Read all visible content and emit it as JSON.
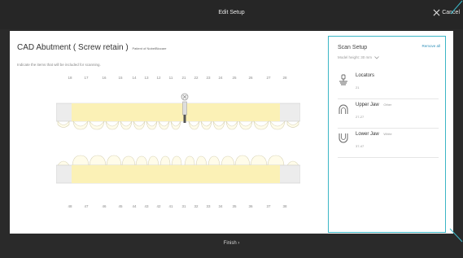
{
  "header": {
    "title": "Edit Setup",
    "cancel_label": "Cancel"
  },
  "main": {
    "title": "CAD Abutment ( Screw retain )",
    "patient": "Patient of NobelBiocare",
    "instruction": "Indicate the items that will be included for scanning.",
    "upper_numbers": [
      "18",
      "17",
      "16",
      "15",
      "14",
      "13",
      "12",
      "11",
      "21",
      "22",
      "23",
      "24",
      "25",
      "26",
      "27",
      "28"
    ],
    "lower_numbers": [
      "48",
      "47",
      "46",
      "45",
      "44",
      "43",
      "42",
      "41",
      "31",
      "32",
      "33",
      "34",
      "35",
      "36",
      "37",
      "38"
    ]
  },
  "scan_setup": {
    "title": "Scan Setup",
    "remove_all": "Remove all",
    "model_height": "Model height: 30 mm",
    "items": [
      {
        "name": "Locators",
        "note": "",
        "teeth": "21",
        "icon": "locator-icon"
      },
      {
        "name": "Upper Jaw",
        "note": "Other",
        "teeth": "27-27",
        "icon": "upper-jaw-icon"
      },
      {
        "name": "Lower Jaw",
        "note": "White",
        "teeth": "37-47",
        "icon": "lower-jaw-icon"
      }
    ]
  },
  "footer": {
    "finish_label": "Finish"
  },
  "colors": {
    "highlight": "#fbf1b6",
    "accent": "#3bb6c6",
    "link": "#2e8fb9",
    "background": "#2a2a2a"
  }
}
